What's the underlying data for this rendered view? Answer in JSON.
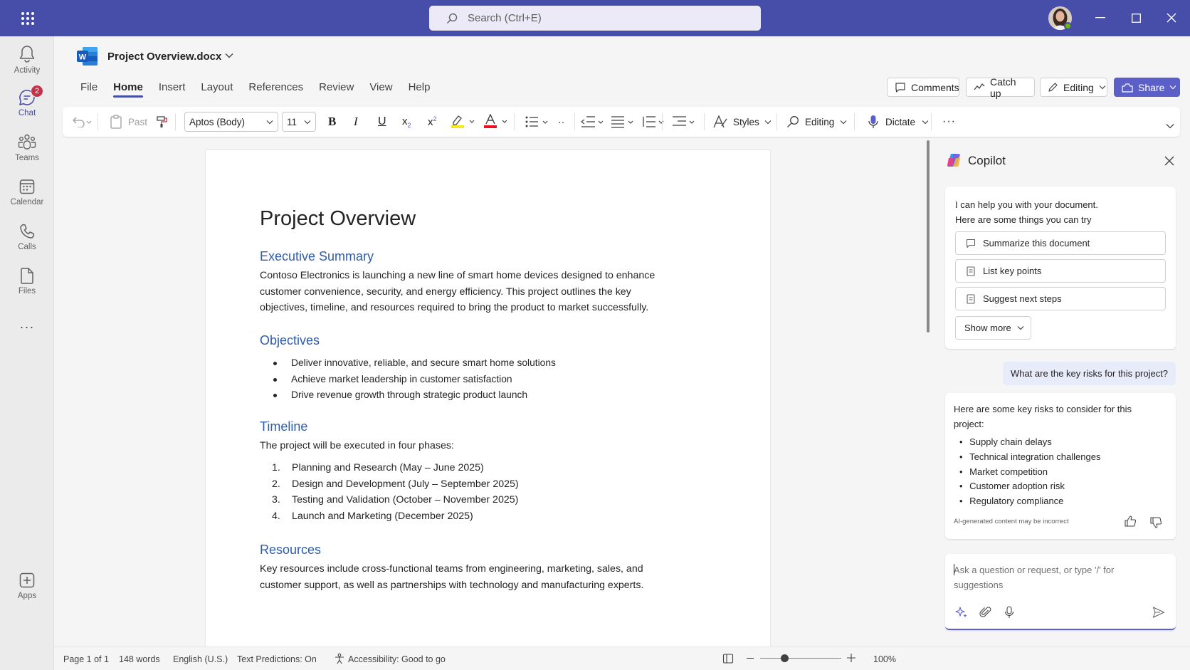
{
  "app": {
    "search_placeholder": "Search (Ctrl+E)"
  },
  "rail": {
    "items": [
      {
        "label": "Activity",
        "icon": "bell-icon"
      },
      {
        "label": "Chat",
        "icon": "chat-icon",
        "badge": "2"
      },
      {
        "label": "Teams",
        "icon": "teams-icon"
      },
      {
        "label": "Calendar",
        "icon": "calendar-icon"
      },
      {
        "label": "Calls",
        "icon": "phone-icon"
      },
      {
        "label": "Files",
        "icon": "file-icon"
      }
    ],
    "more": "···",
    "apps_label": "Apps"
  },
  "document": {
    "file_name": "Project Overview.docx",
    "tabs": [
      "File",
      "Home",
      "Insert",
      "Layout",
      "References",
      "Review",
      "View",
      "Help"
    ],
    "active_tab": "Home",
    "header_buttons": {
      "comments": "Comments",
      "catch_up": "Catch up",
      "editing": "Editing",
      "share": "Share"
    }
  },
  "ribbon": {
    "paste": "Past",
    "font": "Aptos (Body)",
    "size": "11",
    "styles": "Styles",
    "editing": "Editing",
    "dictate": "Dictate",
    "more": "···",
    "highlight_color": "#f8e71c",
    "font_color": "#e81123"
  },
  "page": {
    "title": "Project Overview",
    "sections": {
      "executive": {
        "heading": "Executive Summary",
        "text": "Contoso Electronics is launching a new line of smart home devices designed to enhance customer convenience, security, and energy efficiency. This project outlines the key objectives, timeline, and resources required to bring the product to market successfully."
      },
      "objectives": {
        "heading": "Objectives",
        "items": [
          "Deliver innovative, reliable, and secure smart home solutions",
          "Achieve market leadership in customer satisfaction",
          "Drive revenue growth through strategic product launch"
        ]
      },
      "timeline": {
        "heading": "Timeline",
        "intro": "The project will be executed in four phases:",
        "items": [
          "Planning and Research (May – June 2025)",
          "Design and Development (July – September 2025)",
          "Testing and Validation (October – November 2025)",
          "Launch and Marketing (December 2025)"
        ]
      },
      "resources": {
        "heading": "Resources",
        "text": "Key resources include cross-functional teams from engineering, marketing, sales, and customer support, as well as partnerships with technology and manufacturing experts."
      }
    }
  },
  "status": {
    "page": "Page 1 of 1",
    "words": "148 words",
    "language": "English (U.S.)",
    "predictions": "Text Predictions: On",
    "accessibility": "Accessibility: Good to go",
    "zoom": "100%",
    "zoom_level": 0.3
  },
  "copilot": {
    "title": "Copilot",
    "intro_line1": "I can help you with your document.",
    "intro_line2": "Here are some things you can try",
    "suggestions": [
      "Summarize this document",
      "List key points",
      "Suggest next steps"
    ],
    "show_more": "Show more",
    "user_message": "What are the key risks for this project?",
    "answer_intro": "Here are some key risks to consider for this project:",
    "risks": [
      "Supply chain delays",
      "Technical integration challenges",
      "Market competition",
      "Customer adoption risk",
      "Regulatory compliance"
    ],
    "disclaimer": "AI-generated content may be incorrect",
    "input_placeholder": "Ask a question or request, or type '/' for suggestions"
  }
}
